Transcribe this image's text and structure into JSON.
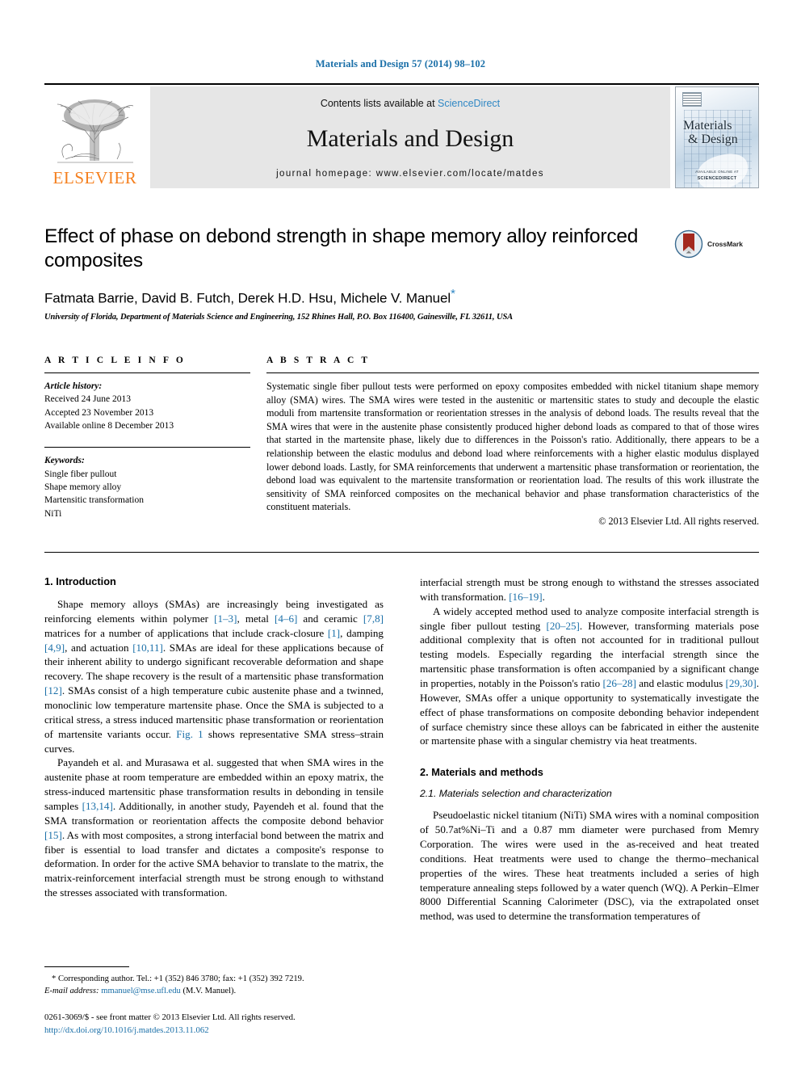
{
  "running_head": "Materials and Design 57 (2014) 98–102",
  "masthead": {
    "publisher_logo_label": "ELSEVIER",
    "contents_prefix": "Contents lists available at ",
    "contents_link": "ScienceDirect",
    "journal_name": "Materials and Design",
    "homepage": "journal homepage: www.elsevier.com/locate/matdes",
    "cover": {
      "title_line1": "Materials",
      "title_line2": "& Design",
      "footer_line1": "AVAILABLE ONLINE AT",
      "footer_line2": "SCIENCEDIRECT"
    }
  },
  "article": {
    "title": "Effect of phase on debond strength in shape memory alloy reinforced composites",
    "authors": "Fatmata Barrie, David B. Futch, Derek H.D. Hsu, Michele V. Manuel",
    "corresponding_marker": "*",
    "affiliation": "University of Florida, Department of Materials Science and Engineering, 152 Rhines Hall, P.O. Box 116400, Gainesville, FL 32611, USA",
    "crossmark_label": "CrossMark"
  },
  "article_info": {
    "heading": "A R T I C L E   I N F O",
    "history_label": "Article history:",
    "history": [
      "Received 24 June 2013",
      "Accepted 23 November 2013",
      "Available online 8 December 2013"
    ],
    "keywords_label": "Keywords:",
    "keywords": [
      "Single fiber pullout",
      "Shape memory alloy",
      "Martensitic transformation",
      "NiTi"
    ]
  },
  "abstract": {
    "heading": "A B S T R A C T",
    "text": "Systematic single fiber pullout tests were performed on epoxy composites embedded with nickel titanium shape memory alloy (SMA) wires. The SMA wires were tested in the austenitic or martensitic states to study and decouple the elastic moduli from martensite transformation or reorientation stresses in the analysis of debond loads. The results reveal that the SMA wires that were in the austenite phase consistently produced higher debond loads as compared to that of those wires that started in the martensite phase, likely due to differences in the Poisson's ratio. Additionally, there appears to be a relationship between the elastic modulus and debond load where reinforcements with a higher elastic modulus displayed lower debond loads. Lastly, for SMA reinforcements that underwent a martensitic phase transformation or reorientation, the debond load was equivalent to the martensite transformation or reorientation load. The results of this work illustrate the sensitivity of SMA reinforced composites on the mechanical behavior and phase transformation characteristics of the constituent materials.",
    "copyright": "© 2013 Elsevier Ltd. All rights reserved."
  },
  "sections": {
    "introduction_heading": "1. Introduction",
    "materials_heading": "2. Materials and methods",
    "materials_sub_heading": "2.1. Materials selection and characterization"
  },
  "paragraphs": {
    "intro_p1_a": "Shape memory alloys (SMAs) are increasingly being investigated as reinforcing elements within polymer ",
    "intro_p1_r1": "[1–3]",
    "intro_p1_b": ", metal ",
    "intro_p1_r2": "[4–6]",
    "intro_p1_c": " and ceramic ",
    "intro_p1_r3": "[7,8]",
    "intro_p1_d": " matrices for a number of applications that include crack-closure ",
    "intro_p1_r4": "[1]",
    "intro_p1_e": ", damping ",
    "intro_p1_r5": "[4,9]",
    "intro_p1_f": ", and actuation ",
    "intro_p1_r6": "[10,11]",
    "intro_p1_g": ". SMAs are ideal for these applications because of their inherent ability to undergo significant recoverable deformation and shape recovery. The shape recovery is the result of a martensitic phase transformation ",
    "intro_p1_r7": "[12]",
    "intro_p1_h": ". SMAs consist of a high temperature cubic austenite phase and a twinned, monoclinic low temperature martensite phase. Once the SMA is subjected to a critical stress, a stress induced martensitic phase transformation or reorientation of martensite variants occur. ",
    "intro_p1_r8": "Fig. 1",
    "intro_p1_i": " shows representative SMA stress–strain curves.",
    "intro_p2_a": "Payandeh et al. and Murasawa et al. suggested that when SMA wires in the austenite phase at room temperature are embedded within an epoxy matrix, the stress-induced martensitic phase transformation results in debonding in tensile samples ",
    "intro_p2_r1": "[13,14]",
    "intro_p2_b": ". Additionally, in another study, Payendeh et al. found that the SMA transformation or reorientation affects the composite debond behavior ",
    "intro_p2_r2": "[15]",
    "intro_p2_c": ". As with most composites, a strong interfacial bond between the matrix and fiber is essential to load transfer and dictates a composite's response to deformation. In order for the active SMA behavior to translate to the matrix, the matrix-reinforcement interfacial strength must be strong enough to withstand the stresses associated with transformation. ",
    "intro_p2_r3": "[16–19]",
    "intro_p2_d": ".",
    "intro_p3_a": "A widely accepted method used to analyze composite interfacial strength is single fiber pullout testing ",
    "intro_p3_r1": "[20–25]",
    "intro_p3_b": ". However, transforming materials pose additional complexity that is often not accounted for in traditional pullout testing models. Especially regarding the interfacial strength since the martensitic phase transformation is often accompanied by a significant change in properties, notably in the Poisson's ratio ",
    "intro_p3_r2": "[26–28]",
    "intro_p3_c": " and elastic modulus ",
    "intro_p3_r3": "[29,30]",
    "intro_p3_d": ". However, SMAs offer a unique opportunity to systematically investigate the effect of phase transformations on composite debonding behavior independent of surface chemistry since these alloys can be fabricated in either the austenite or martensite phase with a singular chemistry via heat treatments.",
    "materials_p1": "Pseudoelastic nickel titanium (NiTi) SMA wires with a nominal composition of 50.7at%Ni–Ti and a 0.87 mm diameter were purchased from Memry Corporation. The wires were used in the as-received and heat treated conditions. Heat treatments were used to change the thermo–mechanical properties of the wires. These heat treatments included a series of high temperature annealing steps followed by a water quench (WQ). A Perkin–Elmer 8000 Differential Scanning Calorimeter (DSC), via the extrapolated onset method, was used to determine the transformation temperatures of"
  },
  "footnote": {
    "marker": "*",
    "corresponding": " Corresponding author. Tel.: +1 (352) 846 3780; fax: +1 (352) 392 7219.",
    "email_label": "E-mail address:",
    "email": "mmanuel@mse.ufl.edu",
    "email_suffix": " (M.V. Manuel)."
  },
  "imprint": {
    "issn_line": "0261-3069/$ - see front matter © 2013 Elsevier Ltd. All rights reserved.",
    "doi": "http://dx.doi.org/10.1016/j.matdes.2013.11.062"
  },
  "colors": {
    "link_blue": "#1a6fa8",
    "science_direct_blue": "#2f87c4",
    "elsevier_orange": "#f5801f",
    "band_gray": "#e6e6e6"
  }
}
